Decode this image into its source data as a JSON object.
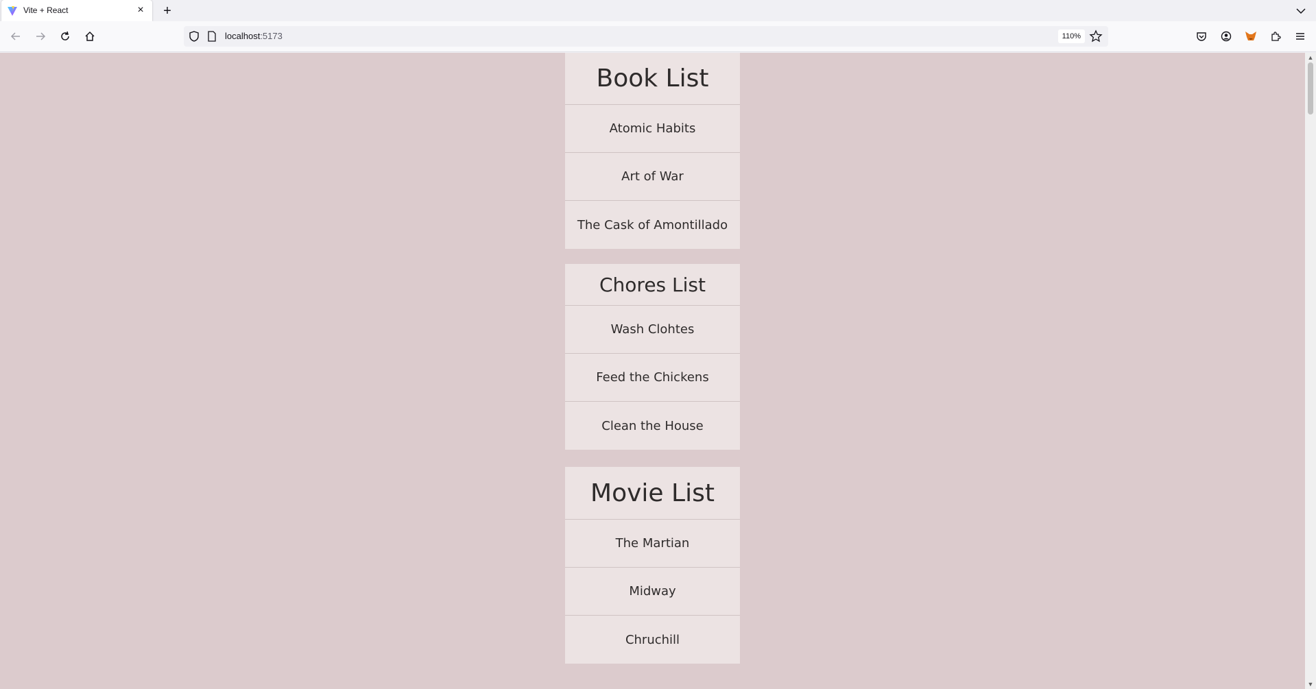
{
  "browser": {
    "tab": {
      "title": "Vite + React",
      "close_glyph": "×"
    },
    "new_tab_glyph": "+",
    "url": {
      "host": "localhost",
      "port": ":5173"
    },
    "zoom": "110%",
    "icons": {
      "back": "back-arrow-icon",
      "forward": "forward-arrow-icon",
      "reload": "reload-icon",
      "home": "home-icon",
      "shield": "shield-icon",
      "page": "page-icon",
      "bookmark": "star-icon",
      "pocket": "pocket-icon",
      "account": "account-icon",
      "extension_fox": "metamask-fox-icon",
      "extensions": "puzzle-icon",
      "menu": "hamburger-menu-icon",
      "tab_list": "chevron-down-icon"
    }
  },
  "colors": {
    "page_background": "#dccbcd",
    "card_background": "#ece3e3",
    "text": "#2e2b2b"
  },
  "lists": [
    {
      "title": "Book List",
      "items": [
        "Atomic Habits",
        "Art of War",
        "The Cask of Amontillado"
      ]
    },
    {
      "title": "Chores List",
      "items": [
        "Wash Clohtes",
        "Feed the Chickens",
        "Clean the House"
      ]
    },
    {
      "title": "Movie List",
      "items": [
        "The Martian",
        "Midway",
        "Chruchill"
      ]
    }
  ]
}
